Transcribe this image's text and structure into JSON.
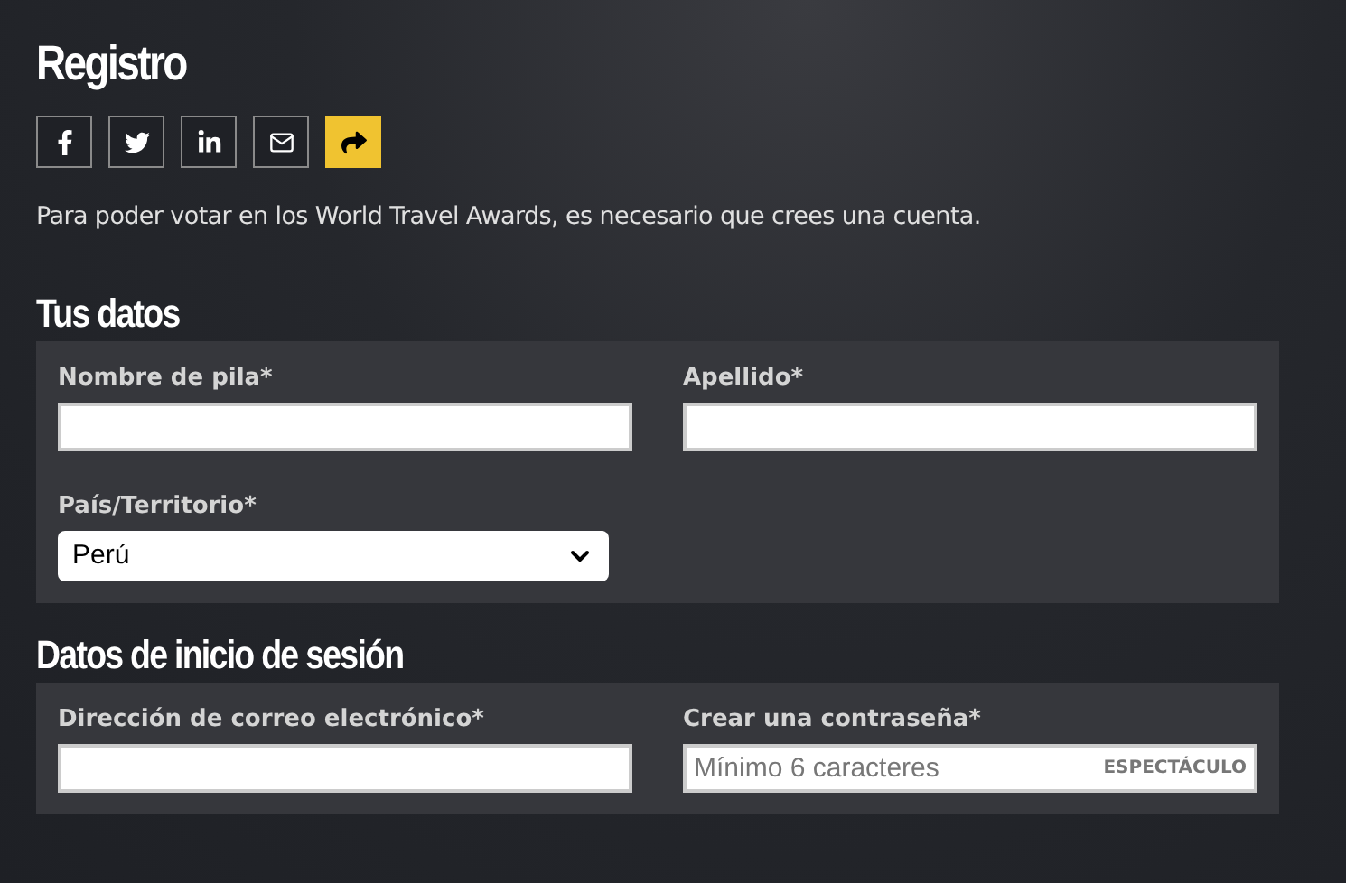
{
  "title": "Registro",
  "share_buttons": [
    {
      "kind": "facebook"
    },
    {
      "kind": "twitter"
    },
    {
      "kind": "linkedin"
    },
    {
      "kind": "email"
    },
    {
      "kind": "share"
    }
  ],
  "intro": "Para poder votar en los World Travel Awards, es necesario que crees una cuenta.",
  "sections": [
    {
      "heading": "Tus datos",
      "fields": [
        {
          "kind": "text",
          "label": "Nombre de pila*"
        },
        {
          "kind": "text",
          "label": "Apellido*"
        },
        {
          "kind": "select",
          "label": "País/Territorio*",
          "value": "Perú"
        }
      ]
    },
    {
      "heading": "Datos de inicio de sesión",
      "fields": [
        {
          "kind": "text",
          "label": "Dirección de correo electrónico*"
        },
        {
          "kind": "password",
          "label": "Crear una contraseña*",
          "placeholder": "Mínimo 6 caracteres",
          "toggle": "ESPECTÁCULO"
        }
      ]
    }
  ]
}
